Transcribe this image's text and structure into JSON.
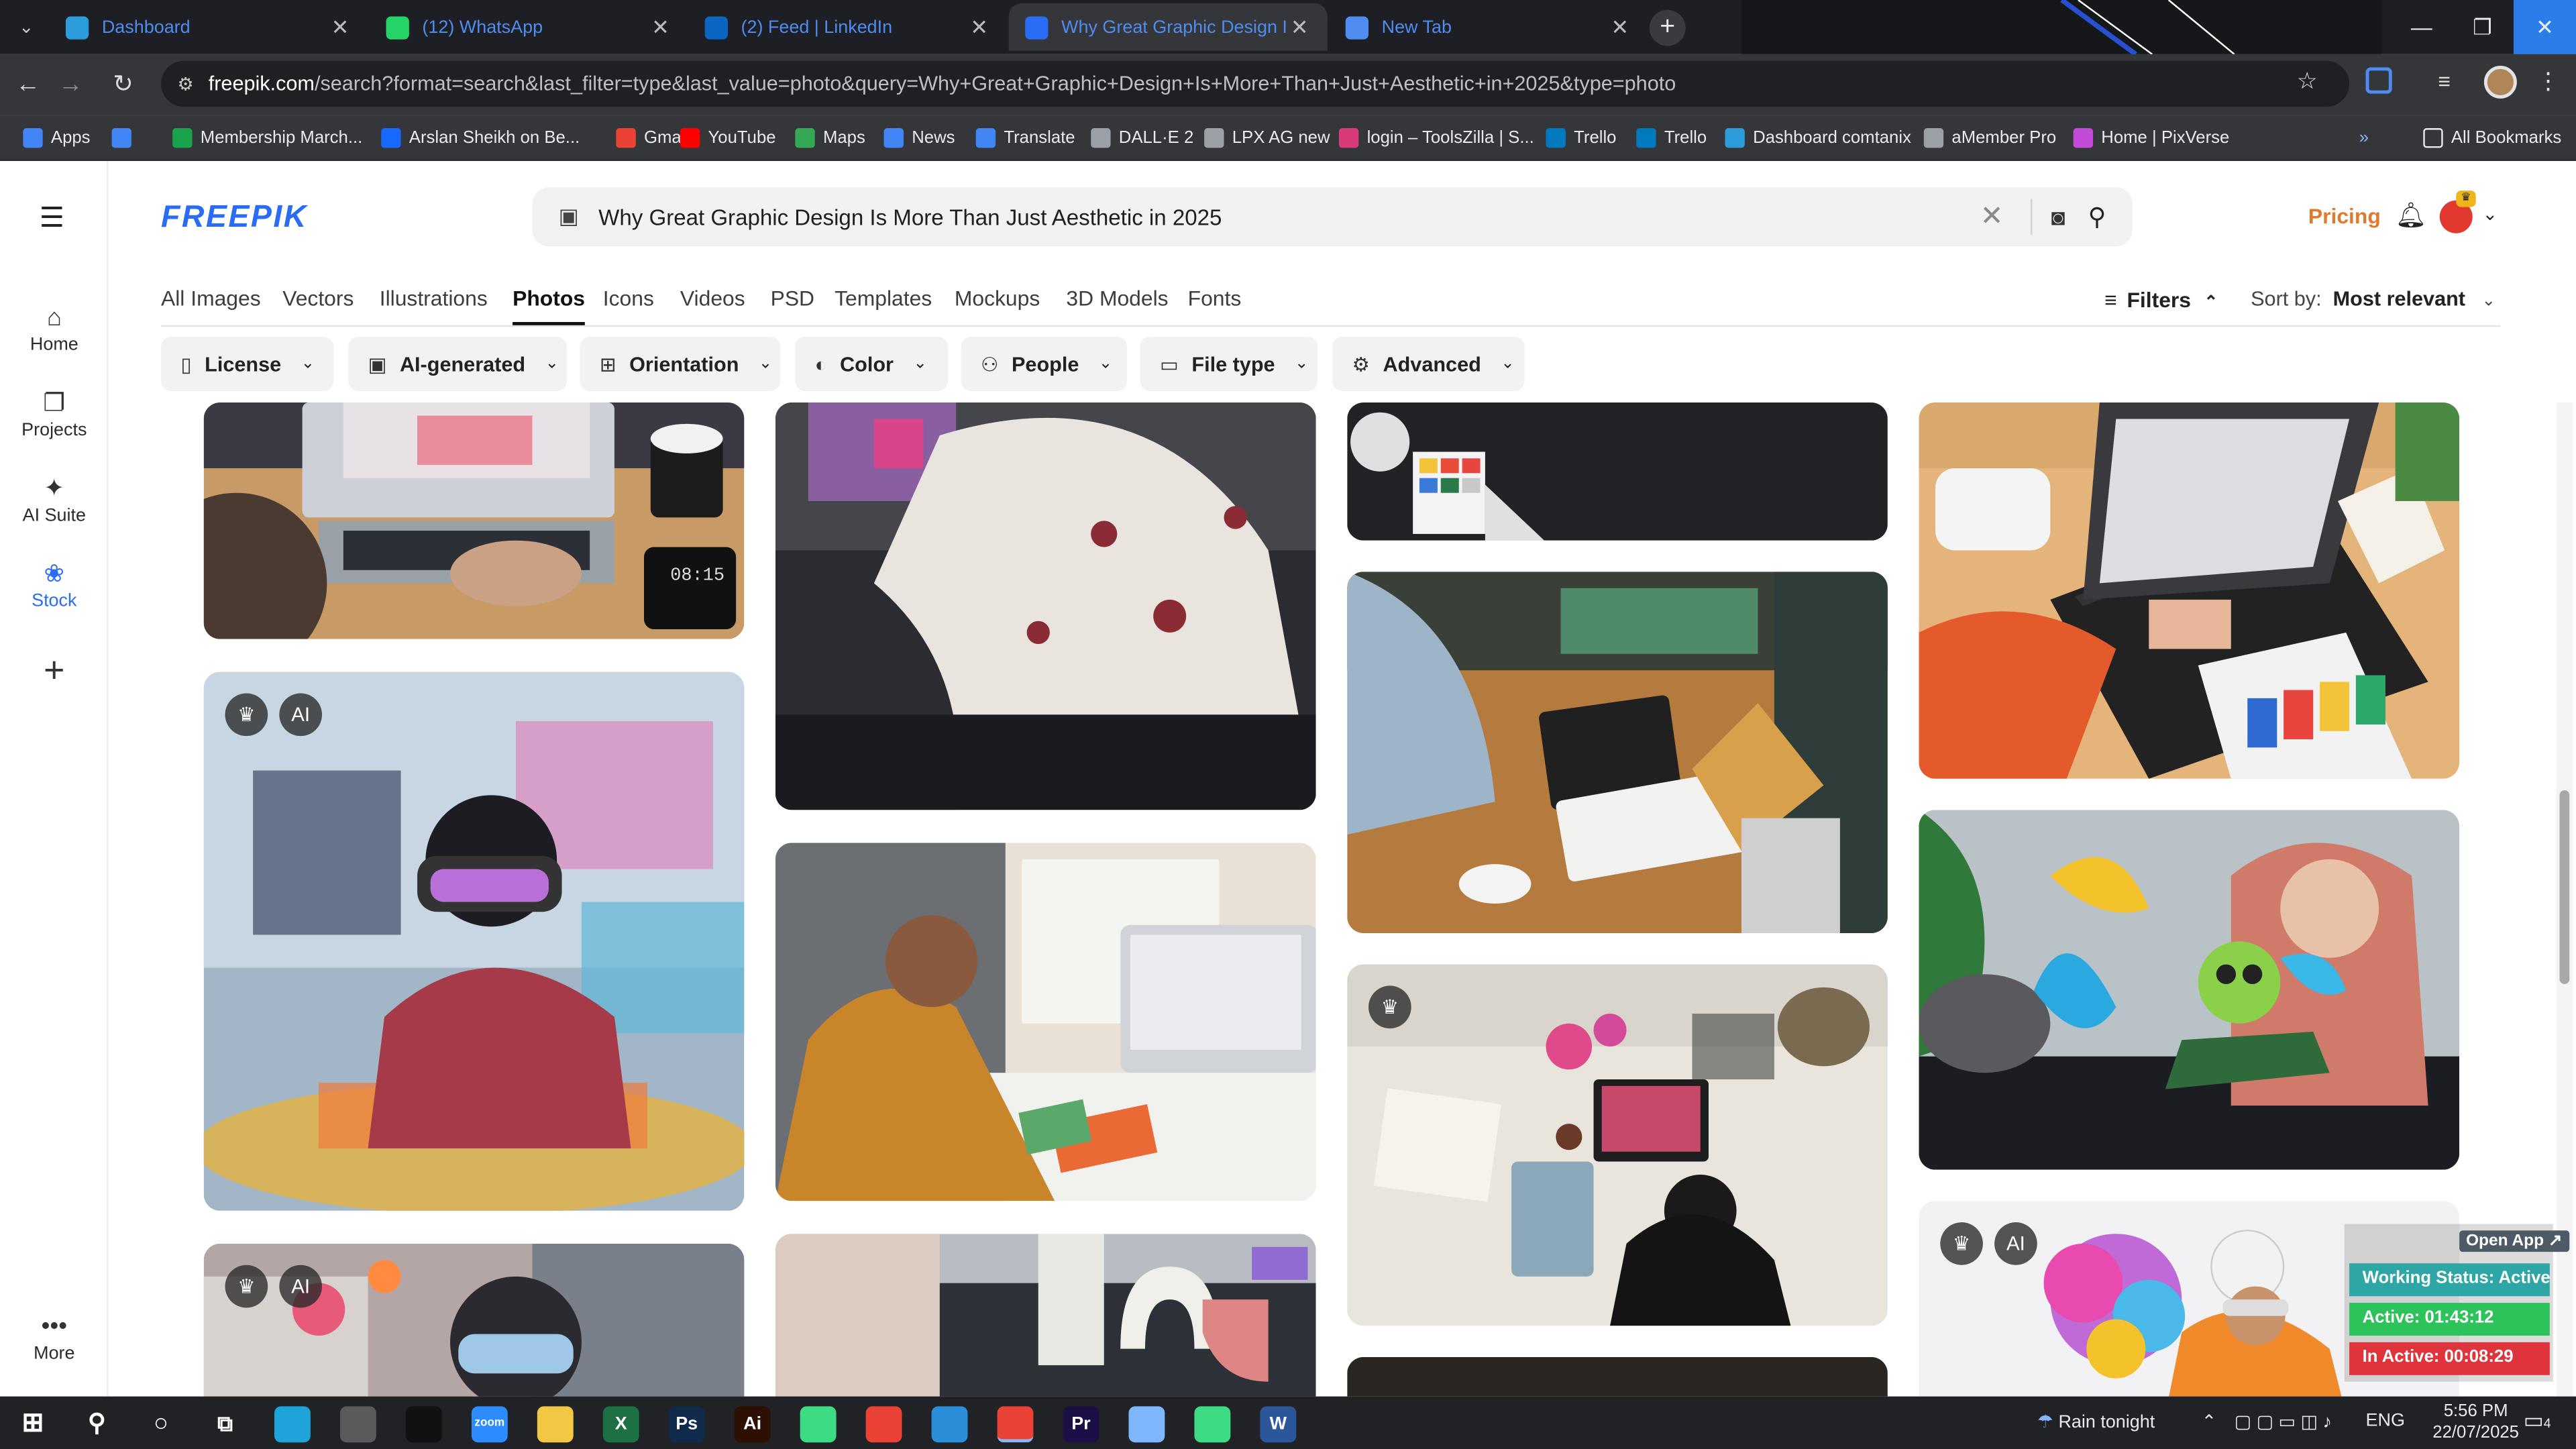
{
  "browser": {
    "tabs": [
      {
        "title": "Dashboard",
        "favicon_color": "#2d9cdb"
      },
      {
        "title": "(12) WhatsApp",
        "favicon_color": "#25d366"
      },
      {
        "title": "(2) Feed | LinkedIn",
        "favicon_color": "#0a66c2"
      },
      {
        "title": "Why Great Graphic Design Is M",
        "favicon_color": "#2a6df4"
      },
      {
        "title": "New Tab",
        "favicon_color": "#4e8cf0"
      }
    ],
    "active_tab_index": 3,
    "new_tab_label": "+",
    "url_host": "freepik.com",
    "url_rest": "/search?format=search&last_filter=type&last_value=photo&query=Why+Great+Graphic+Design+Is+More+Than+Just+Aesthetic+in+2025&type=photo",
    "bookmarks": [
      {
        "label": "Apps",
        "color": "#4285f4"
      },
      {
        "label": "",
        "color": "#4285f4"
      },
      {
        "label": "Membership March...",
        "color": "#19a34a"
      },
      {
        "label": "Arslan Sheikh on Be...",
        "color": "#1769ff"
      },
      {
        "label": "Gmail",
        "color": "#ea4335"
      },
      {
        "label": "YouTube",
        "color": "#ff0000"
      },
      {
        "label": "Maps",
        "color": "#34a853"
      },
      {
        "label": "News",
        "color": "#4285f4"
      },
      {
        "label": "Translate",
        "color": "#4285f4"
      },
      {
        "label": "DALL·E 2",
        "color": "#9aa0a6"
      },
      {
        "label": "LPX AG new",
        "color": "#9aa0a6"
      },
      {
        "label": "login – ToolsZilla | S...",
        "color": "#d93a7a"
      },
      {
        "label": "Trello",
        "color": "#0079bf"
      },
      {
        "label": "Trello",
        "color": "#0079bf"
      },
      {
        "label": "Dashboard comtanix",
        "color": "#2d9cdb"
      },
      {
        "label": "aMember Pro",
        "color": "#9aa0a6"
      },
      {
        "label": "Home | PixVerse",
        "color": "#c34bd8"
      }
    ],
    "all_bookmarks_label": "All Bookmarks"
  },
  "site": {
    "logo": "FREEPIK",
    "search_query": "Why Great Graphic Design Is More Than Just Aesthetic in 2025",
    "pricing_label": "Pricing",
    "left_nav": [
      {
        "label": "Home",
        "icon": "home-icon"
      },
      {
        "label": "Projects",
        "icon": "projects-icon"
      },
      {
        "label": "AI Suite",
        "icon": "sparkle-icon"
      },
      {
        "label": "Stock",
        "icon": "stock-icon",
        "active": true
      },
      {
        "label": "",
        "icon": "plus-icon"
      },
      {
        "label": "More",
        "icon": "more-icon"
      }
    ],
    "categories": [
      "All Images",
      "Vectors",
      "Illustrations",
      "Photos",
      "Icons",
      "Videos",
      "PSD",
      "Templates",
      "Mockups",
      "3D Models",
      "Fonts"
    ],
    "active_category": "Photos",
    "filters_label": "Filters",
    "sort_label": "Sort by:",
    "sort_value": "Most relevant",
    "filter_pills": [
      {
        "label": "License",
        "icon": "license-icon"
      },
      {
        "label": "AI-generated",
        "icon": "ai-icon"
      },
      {
        "label": "Orientation",
        "icon": "orientation-icon"
      },
      {
        "label": "Color",
        "icon": "palette-icon"
      },
      {
        "label": "People",
        "icon": "people-icon"
      },
      {
        "label": "File type",
        "icon": "file-icon"
      },
      {
        "label": "Advanced",
        "icon": "settings-icon"
      }
    ],
    "accent_color": "#2a6df4",
    "pricing_color": "#e07a2c"
  },
  "results": [
    {
      "subject": "hands typing on laptop with coffee and phone timer",
      "phone_time": "08:15",
      "premium": false,
      "ai": false
    },
    {
      "subject": "woman wearing VR headset creating colorful art",
      "premium": true,
      "ai": true
    },
    {
      "subject": "woman wearing VR headset among floating art",
      "premium": true,
      "ai": true
    },
    {
      "subject": "person in floral shirt at desk",
      "premium": false,
      "ai": false
    },
    {
      "subject": "designer sketching wireframes at desk",
      "premium": false,
      "ai": false
    },
    {
      "subject": "3D shapes on monitor",
      "premium": false,
      "ai": false
    },
    {
      "subject": "color swatches on dark desk",
      "premium": false,
      "ai": false
    },
    {
      "subject": "designer drawing on graphic tablet",
      "premium": false,
      "ai": false
    },
    {
      "subject": "overhead view of woman drawing on tablet",
      "premium": true,
      "ai": false
    },
    {
      "subject": "hands on laptop with color palette",
      "premium": false,
      "ai": false
    },
    {
      "subject": "woman with tablet and cartoon character",
      "premium": false,
      "ai": false
    },
    {
      "subject": "surreal colorful AI portrait",
      "premium": true,
      "ai": true
    }
  ],
  "overlay_widget": {
    "open_app_label": "Open App ↗",
    "working_status": "Working Status: Active",
    "active_time": "Active: 01:43:12",
    "inactive_time": "In Active: 00:08:29",
    "colors": {
      "status": "#2ea6a6",
      "active": "#2ec35a",
      "inactive": "#e0343c"
    }
  },
  "taskbar": {
    "apps": [
      {
        "name": "edge",
        "color": "#1ea4d9"
      },
      {
        "name": "pen",
        "color": "#5a5a5a"
      },
      {
        "name": "terminal",
        "color": "#111111"
      },
      {
        "name": "zoom",
        "color": "#2d8cff"
      },
      {
        "name": "explorer",
        "color": "#f2c744"
      },
      {
        "name": "excel",
        "color": "#1d7044"
      },
      {
        "name": "photoshop",
        "color": "#0f2a4a"
      },
      {
        "name": "illustrator",
        "color": "#2d0f04"
      },
      {
        "name": "android",
        "color": "#3ddc84"
      },
      {
        "name": "chrome",
        "color": "#ea4335"
      },
      {
        "name": "vscode",
        "color": "#2a8fd8"
      },
      {
        "name": "chrome-active",
        "color": "#ea4335"
      },
      {
        "name": "premiere",
        "color": "#1c0f46"
      },
      {
        "name": "app",
        "color": "#7fb7ff"
      },
      {
        "name": "android",
        "color": "#3ddc84"
      },
      {
        "name": "word",
        "color": "#2b579a"
      }
    ],
    "icon_labels": {
      "zoom": "zoom",
      "ps": "Ps",
      "ai": "Ai",
      "pr": "Pr",
      "x": "X",
      "w": "W"
    },
    "weather": "Rain tonight",
    "language": "ENG",
    "time": "5:56 PM",
    "date": "22/07/2025",
    "notification_count": "4"
  }
}
